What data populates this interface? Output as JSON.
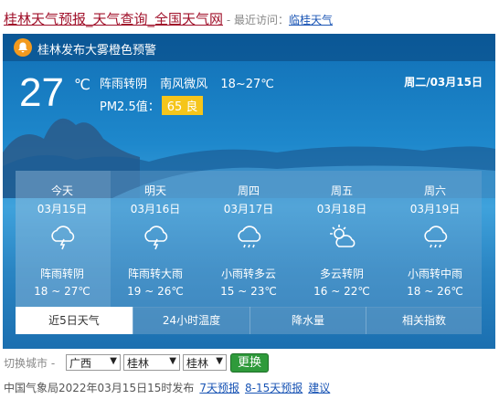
{
  "header": {
    "site_title": "桂林天气预报_天气查询_全国天气网",
    "recent_label": "- 最近访问：",
    "recent_link": "临桂天气"
  },
  "alert": {
    "text": "桂林发布大雾橙色预警",
    "icon": "bell-icon",
    "color": "#f39a1e"
  },
  "current": {
    "temp": "27",
    "unit": "℃",
    "weather": "阵雨转阴",
    "wind": "南风微风",
    "range": "18~27℃",
    "pm_label": "PM2.5值：",
    "aqi": "65 良",
    "aqi_color": "#f5c51b",
    "date": "周二/03月15日"
  },
  "forecast": [
    {
      "label": "今天",
      "date": "03月15日",
      "icon": "thunder-shower-icon",
      "desc": "阵雨转阴",
      "range": "18 ~ 27℃"
    },
    {
      "label": "明天",
      "date": "03月16日",
      "icon": "thunder-shower-icon",
      "desc": "阵雨转大雨",
      "range": "19 ~ 26℃"
    },
    {
      "label": "周四",
      "date": "03月17日",
      "icon": "light-rain-icon",
      "desc": "小雨转多云",
      "range": "15 ~ 23℃"
    },
    {
      "label": "周五",
      "date": "03月18日",
      "icon": "partly-cloudy-icon",
      "desc": "多云转阴",
      "range": "16 ~ 22℃"
    },
    {
      "label": "周六",
      "date": "03月19日",
      "icon": "light-rain-icon",
      "desc": "小雨转中雨",
      "range": "18 ~ 26℃"
    }
  ],
  "tabs": [
    "近5日天气",
    "24小时温度",
    "降水量",
    "相关指数"
  ],
  "switcher": {
    "label": "切换城市 -",
    "province": "广西",
    "city": "桂林",
    "district": "桂林",
    "button": "更换"
  },
  "footer": {
    "publish": "中国气象局2022年03月15日15时发布",
    "link_7day": "7天预报",
    "link_15day": "8-15天预报",
    "link_suggest": "建议"
  }
}
